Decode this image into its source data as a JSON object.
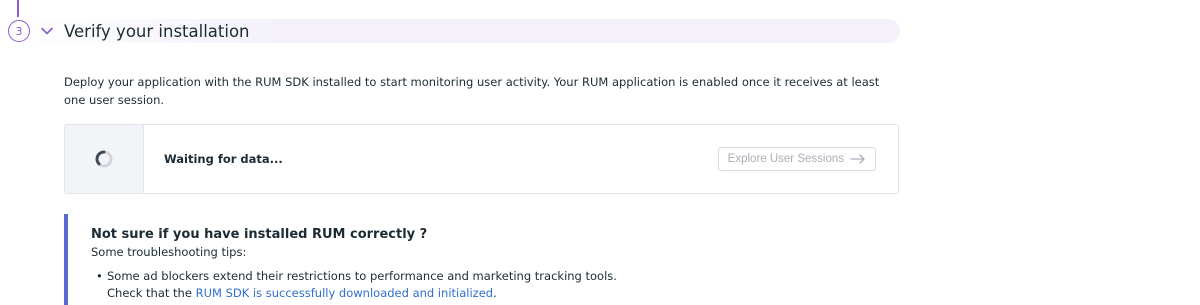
{
  "step": {
    "number": "3",
    "title": "Verify your installation"
  },
  "description": "Deploy your application with the RUM SDK installed to start monitoring user activity. Your RUM application is enabled once it receives at least one user session.",
  "status": {
    "text": "Waiting for data...",
    "button_label": "Explore User Sessions"
  },
  "callout": {
    "title": "Not sure if you have installed RUM correctly ?",
    "subtitle": "Some troubleshooting tips:",
    "tips": [
      {
        "line1": "Some ad blockers extend their restrictions to performance and marketing tracking tools.",
        "line2_prefix": "Check that the ",
        "link_text": "RUM SDK is successfully downloaded and initialized",
        "line2_suffix": "."
      }
    ]
  },
  "icons": {
    "chevron": "chevron-down-icon",
    "spinner": "loading-spinner-icon",
    "arrow": "arrow-right-icon"
  },
  "colors": {
    "step_accent": "#8a5bc9",
    "callout_border": "#5b6ad0",
    "link": "#2f6fd0",
    "disabled_text": "#a9aeb6"
  }
}
